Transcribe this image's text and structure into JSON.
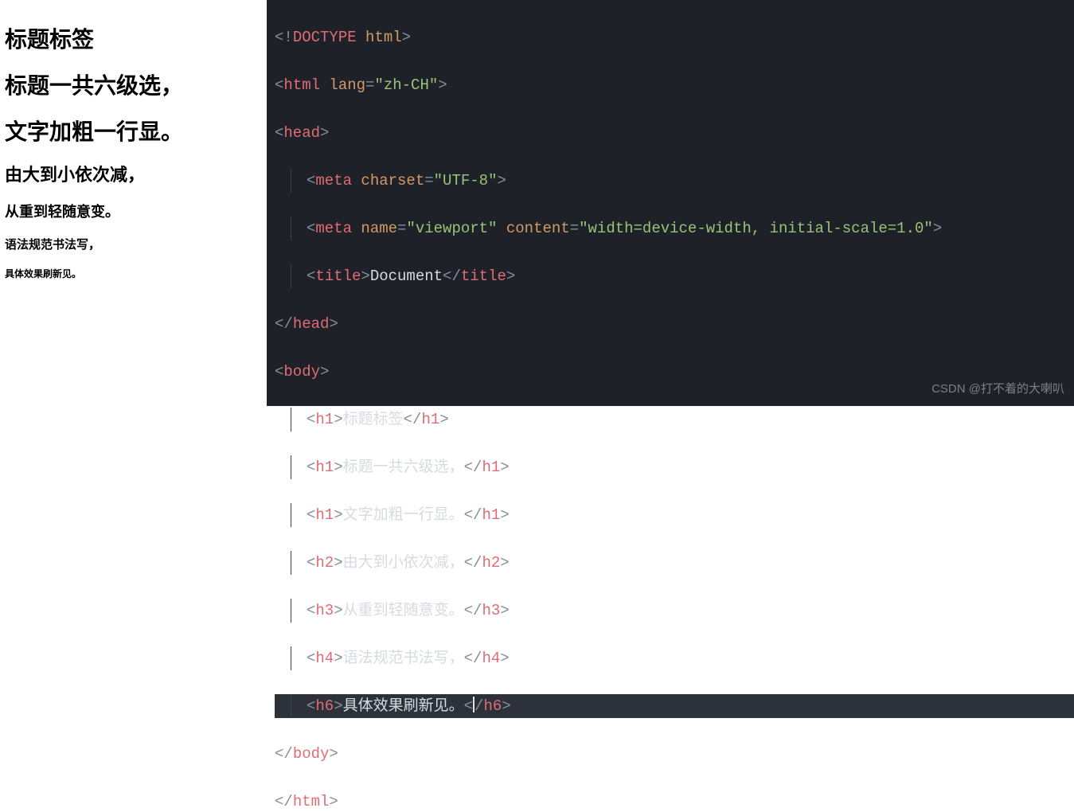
{
  "preview": {
    "h1_a": "标题标签",
    "h1_b": "标题一共六级选，",
    "h1_c": "文字加粗一行显。",
    "h2": "由大到小依次减，",
    "h3": "从重到轻随意变。",
    "h4": "语法规范书法写，",
    "h6": "具体效果刷新见。"
  },
  "code": {
    "doctype": "DOCTYPE",
    "html_word": "html",
    "lang_attr": "lang",
    "lang_val": "\"zh-CH\"",
    "head": "head",
    "meta": "meta",
    "charset_attr": "charset",
    "charset_val": "\"UTF-8\"",
    "name_attr": "name",
    "name_val": "\"viewport\"",
    "content_attr": "content",
    "content_val": "\"width=device-width, initial-scale=1.0\"",
    "title": "title",
    "title_text": "Document",
    "body": "body",
    "h1": "h1",
    "h2": "h2",
    "h3": "h3",
    "h4": "h4",
    "h6": "h6",
    "t1": "标题标签",
    "t2": "标题一共六级选，",
    "t3": "文字加粗一行显。",
    "t4": "由大到小依次减，",
    "t5": "从重到轻随意变。",
    "t6": "语法规范书法写，",
    "t7": "具体效果刷新见。"
  },
  "watermark": "CSDN @打不着的大喇叭"
}
